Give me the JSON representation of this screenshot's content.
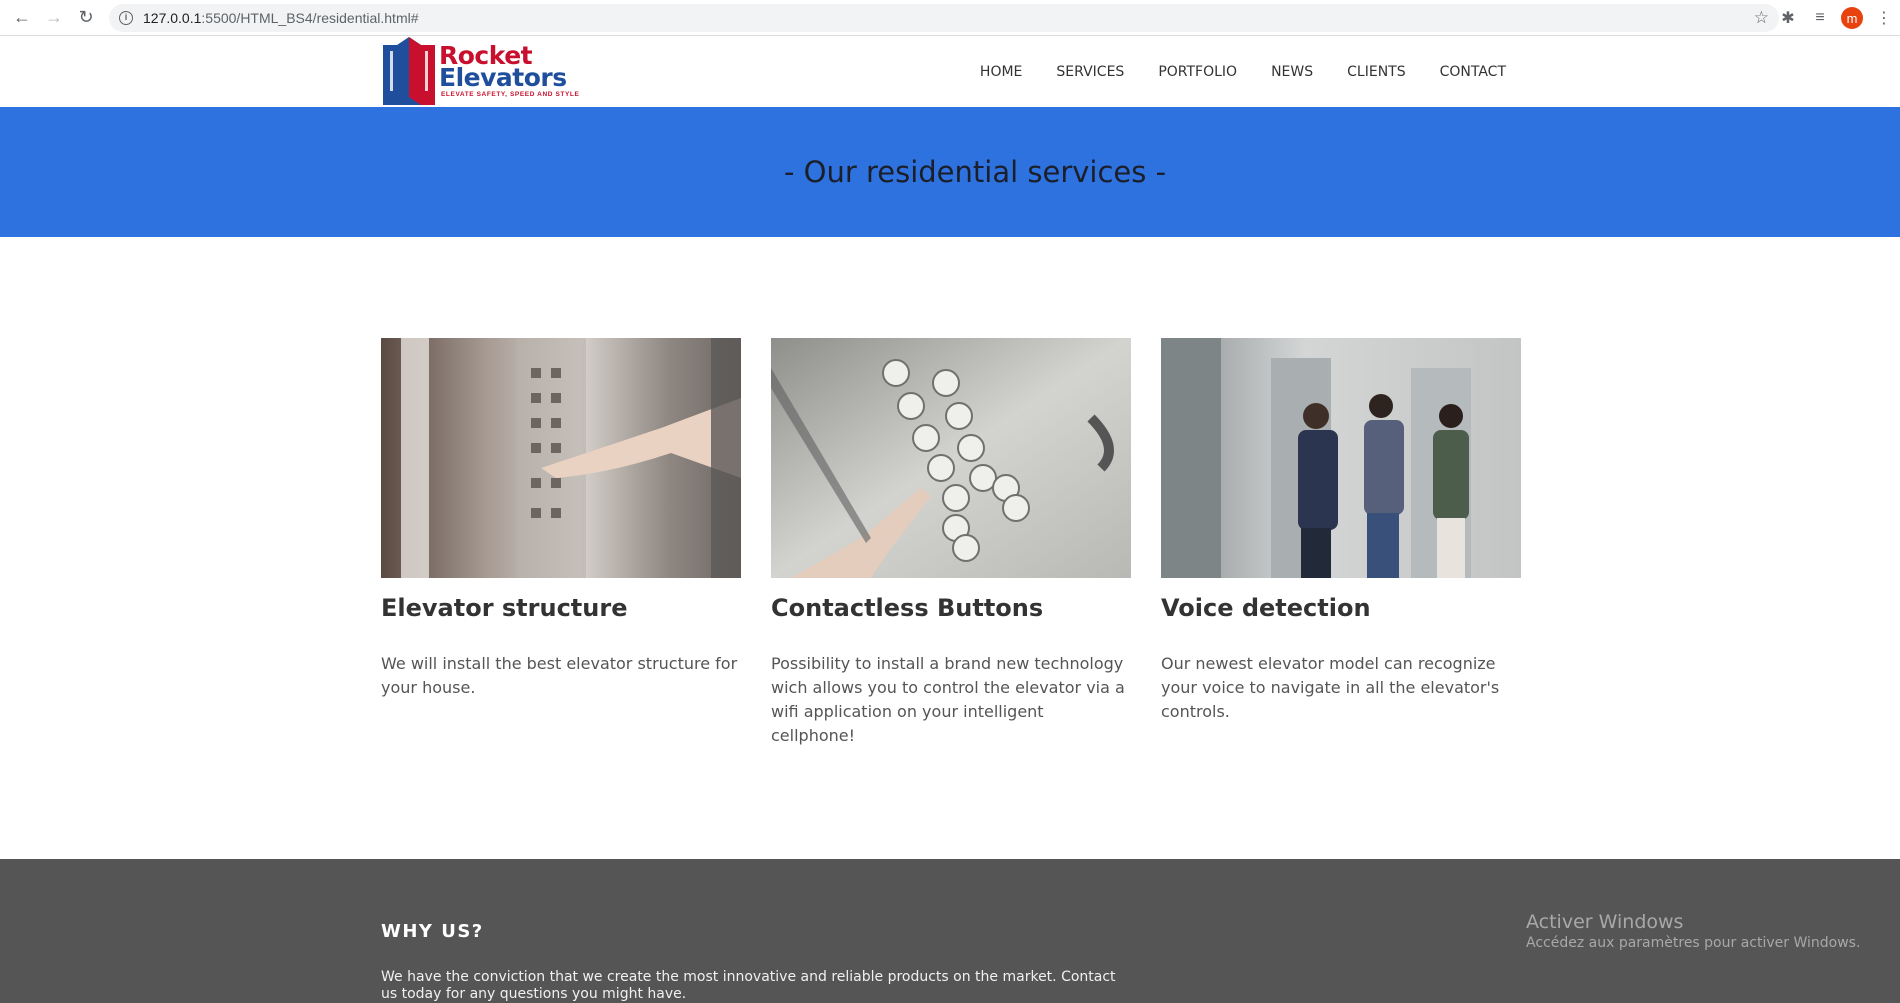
{
  "browser": {
    "url_host": "127.0.0.1",
    "url_rest": ":5500/HTML_BS4/residential.html#",
    "profile_initial": "m"
  },
  "logo": {
    "line1": "Rocket",
    "line2": "Elevators",
    "tagline": "ELEVATE SAFETY, SPEED AND STYLE"
  },
  "nav": {
    "home": "HOME",
    "services": "SERVICES",
    "portfolio": "PORTFOLIO",
    "news": "NEWS",
    "clients": "CLIENTS",
    "contact": "CONTACT"
  },
  "banner": {
    "title": "- Our residential services -"
  },
  "cards": [
    {
      "title": "Elevator structure",
      "text": "We will install the best elevator structure for your house."
    },
    {
      "title": "Contactless Buttons",
      "text": "Possibility to install a brand new technology wich allows you to control the elevator via a wifi application on your intelligent cellphone!"
    },
    {
      "title": "Voice detection",
      "text": "Our newest elevator model can recognize your voice to navigate in all the elevator's controls."
    }
  ],
  "footer": {
    "heading": "WHY US?",
    "text": "We have the conviction that we create the most innovative and reliable products on the market. Contact us today for any questions you might have."
  },
  "watermark": {
    "line1": "Activer Windows",
    "line2": "Accédez aux paramètres pour activer Windows."
  },
  "colors": {
    "banner": "#2e72e0",
    "footer": "#555555",
    "brand_red": "#c8102e",
    "brand_blue": "#1f4f9c"
  }
}
